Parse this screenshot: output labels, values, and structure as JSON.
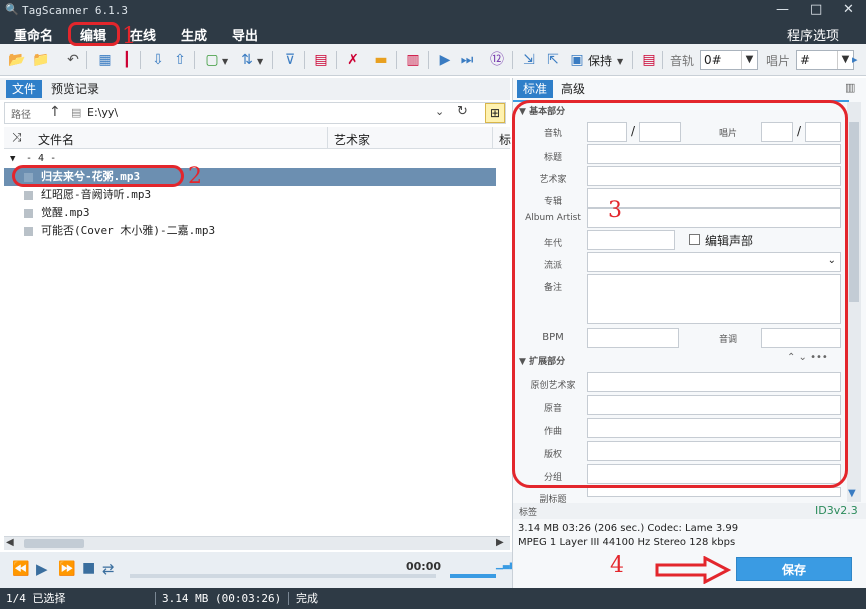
{
  "app": {
    "title": "TagScanner 6.1.3"
  },
  "window_controls": {
    "minimize": "—",
    "maximize": "□",
    "close": "✕"
  },
  "menu": {
    "items": [
      "重命名",
      "编辑",
      "在线",
      "生成",
      "导出"
    ],
    "options": "程序选项"
  },
  "toolbar": {
    "save_label": "保持",
    "track_label": "音轨",
    "track_value": "0#",
    "disc_label": "唱片",
    "disc_value": "#"
  },
  "left_tabs": [
    "文件",
    "预览记录"
  ],
  "path": {
    "label": "路径",
    "value": "E:\\yy\\"
  },
  "columns": [
    "文件名",
    "艺术家",
    "标"
  ],
  "group": {
    "label": "- 4 -"
  },
  "files": [
    "归去来兮-花粥.mp3",
    "红昭愿-音阙诗听.mp3",
    "觉醒.mp3",
    "可能否(Cover 木小雅)-二嘉.mp3"
  ],
  "player": {
    "time": "00:00"
  },
  "right_tabs": [
    "标准",
    "高级"
  ],
  "tag_editor": {
    "section_basic": "基本部分",
    "fields": {
      "track": "音轨",
      "disc": "唱片",
      "title": "标题",
      "artist": "艺术家",
      "album": "专辑",
      "album_artist": "Album Artist",
      "year": "年代",
      "edit_voice": "编辑声部",
      "genre": "流派",
      "comment": "备注",
      "bpm": "BPM",
      "key": "音调"
    },
    "section_ext": "扩展部分",
    "ext_fields": [
      "原创艺术家",
      "原音",
      "作曲",
      "版权",
      "分组"
    ],
    "cut_field": "副标题",
    "footer_label": "标签",
    "tag_version": "ID3v2.3"
  },
  "file_info": {
    "line1": "3.14 MB  03:26 (206 sec.)  Codec: Lame 3.99",
    "line2": "MPEG 1 Layer III  44100 Hz  Stereo  128 kbps"
  },
  "save_button": "保存",
  "status": {
    "selected": "1/4 已选择",
    "size": "3.14 MB  (00:03:26)",
    "state": "完成"
  },
  "annotations": [
    "1",
    "2",
    "3",
    "4"
  ]
}
